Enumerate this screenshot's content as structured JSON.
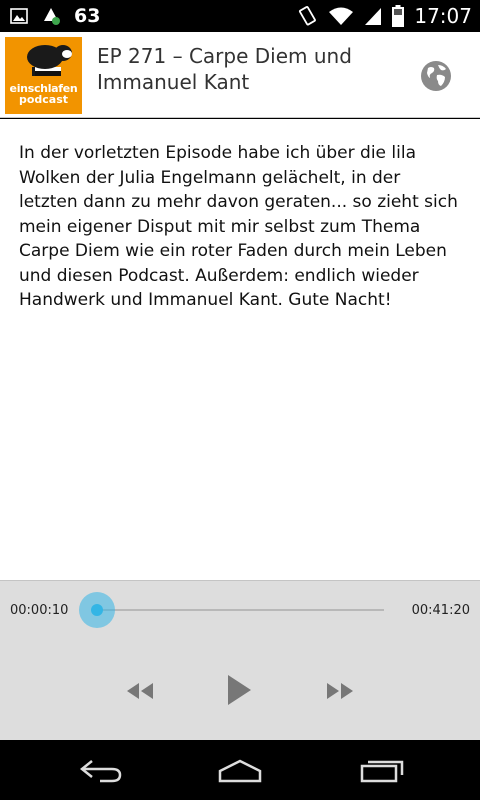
{
  "status_bar": {
    "notification_count": "63",
    "time": "17:07",
    "icons": [
      "image-notification-icon",
      "app-notification-icon",
      "vibrate-icon",
      "wifi-icon",
      "signal-icon",
      "battery-icon"
    ]
  },
  "episode": {
    "podcast_logo": {
      "line1": "einschlafen",
      "line2": "podcast"
    },
    "title": "EP 271 – Carpe Diem und Immanuel Kant",
    "website_icon": "globe-icon"
  },
  "description": "In der vorletzten Episode habe ich über die lila Wolken der Julia Engelmann gelächelt, in der letzten dann zu mehr davon geraten... so zieht sich mein eigener Disput mit mir selbst zum Thema Carpe Diem wie ein roter Faden durch mein Leben und diesen Podcast. Außerdem: endlich wieder Handwerk und Immanuel Kant. Gute Nacht!",
  "player": {
    "current_time": "00:00:10",
    "total_time": "00:41:20",
    "progress_fraction": 0.004,
    "controls": [
      "rewind-icon",
      "play-icon",
      "fast-forward-icon"
    ]
  },
  "colors": {
    "accent": "#33b5e5",
    "logo_background": "#f29400",
    "player_background": "#dddddd"
  },
  "nav_bar": {
    "buttons": [
      "back-icon",
      "home-icon",
      "recent-apps-icon"
    ]
  }
}
